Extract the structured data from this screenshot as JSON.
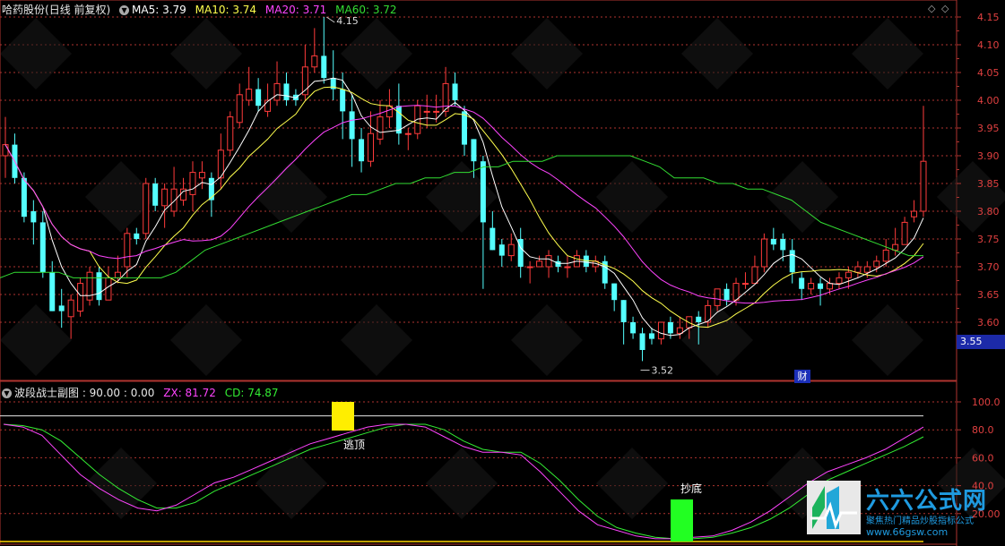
{
  "main_panel": {
    "stock_name": "哈药股份",
    "period": "(日线 前复权)",
    "ma5": "MA5: 3.79",
    "ma10": "MA10: 3.74",
    "ma20": "MA20: 3.71",
    "ma60": "MA60: 3.72",
    "high_mark": "4.15",
    "low_mark": "3.52",
    "price_tag": "3.55",
    "fin_badge": "财"
  },
  "sub_panel": {
    "title": "波段战士副图 : 90.00 : 0.00",
    "zx": "ZX: 81.72",
    "cd": "CD: 74.87",
    "escape_label": "逃顶",
    "bottom_label": "抄底"
  },
  "watermark": {
    "logo_text": "六六公式网",
    "tagline": "聚焦热门精品炒股指标公式",
    "url": "www.66gsw.com"
  },
  "colors": {
    "up": "#ff3b3b",
    "down": "#54ffff",
    "ma5": "#ffffff",
    "ma10": "#ffff4d",
    "ma20": "#ff44ff",
    "ma60": "#33dd33",
    "axis": "#b0342f",
    "zx": "#ff44ff",
    "cd": "#33ee33"
  },
  "chart_data": [
    {
      "type": "candlestick",
      "y_ticks": [
        4.15,
        4.1,
        4.05,
        4.0,
        3.95,
        3.9,
        3.85,
        3.8,
        3.75,
        3.7,
        3.65,
        3.6
      ],
      "ylim": [
        3.52,
        4.16
      ],
      "candles": [
        [
          3.9,
          3.92,
          3.86,
          3.97
        ],
        [
          3.92,
          3.86,
          3.85,
          3.94
        ],
        [
          3.86,
          3.79,
          3.78,
          3.87
        ],
        [
          3.8,
          3.78,
          3.74,
          3.82
        ],
        [
          3.78,
          3.69,
          3.68,
          3.8
        ],
        [
          3.69,
          3.62,
          3.62,
          3.71
        ],
        [
          3.63,
          3.62,
          3.59,
          3.66
        ],
        [
          3.61,
          3.64,
          3.57,
          3.65
        ],
        [
          3.62,
          3.67,
          3.61,
          3.68
        ],
        [
          3.64,
          3.69,
          3.63,
          3.7
        ],
        [
          3.69,
          3.64,
          3.63,
          3.7
        ],
        [
          3.64,
          3.68,
          3.64,
          3.7
        ],
        [
          3.68,
          3.69,
          3.67,
          3.72
        ],
        [
          3.7,
          3.76,
          3.68,
          3.77
        ],
        [
          3.76,
          3.75,
          3.74,
          3.77
        ],
        [
          3.76,
          3.85,
          3.75,
          3.86
        ],
        [
          3.85,
          3.81,
          3.8,
          3.86
        ],
        [
          3.81,
          3.84,
          3.77,
          3.85
        ],
        [
          3.8,
          3.84,
          3.79,
          3.88
        ],
        [
          3.82,
          3.84,
          3.81,
          3.86
        ],
        [
          3.83,
          3.87,
          3.8,
          3.89
        ],
        [
          3.86,
          3.87,
          3.84,
          3.89
        ],
        [
          3.86,
          3.82,
          3.79,
          3.87
        ],
        [
          3.86,
          3.91,
          3.84,
          3.94
        ],
        [
          3.91,
          3.97,
          3.9,
          3.98
        ],
        [
          3.96,
          4.01,
          3.95,
          4.03
        ],
        [
          4.0,
          4.02,
          3.99,
          4.06
        ],
        [
          4.02,
          3.99,
          3.98,
          4.04
        ],
        [
          3.98,
          4.0,
          3.97,
          4.03
        ],
        [
          4.0,
          4.03,
          3.99,
          4.07
        ],
        [
          4.03,
          4.0,
          3.99,
          4.05
        ],
        [
          4.01,
          4.0,
          3.99,
          4.02
        ],
        [
          4.01,
          4.06,
          4.0,
          4.1
        ],
        [
          4.06,
          4.08,
          4.05,
          4.13
        ],
        [
          4.08,
          4.04,
          4.03,
          4.15
        ],
        [
          4.04,
          4.02,
          4.0,
          4.09
        ],
        [
          4.02,
          3.98,
          3.93,
          4.05
        ],
        [
          3.98,
          3.93,
          3.88,
          4.01
        ],
        [
          3.93,
          3.89,
          3.87,
          3.95
        ],
        [
          3.89,
          3.94,
          3.88,
          3.98
        ],
        [
          3.93,
          3.97,
          3.92,
          4.0
        ],
        [
          3.97,
          3.99,
          3.95,
          4.02
        ],
        [
          3.99,
          3.94,
          3.92,
          4.03
        ],
        [
          3.94,
          3.94,
          3.91,
          3.95
        ],
        [
          3.94,
          3.99,
          3.93,
          4.0
        ],
        [
          3.98,
          3.98,
          3.95,
          4.01
        ],
        [
          3.98,
          3.98,
          3.96,
          4.01
        ],
        [
          3.98,
          4.03,
          3.97,
          4.06
        ],
        [
          4.03,
          4.0,
          3.99,
          4.05
        ],
        [
          3.98,
          3.92,
          3.9,
          3.99
        ],
        [
          3.93,
          3.89,
          3.86,
          3.93
        ],
        [
          3.89,
          3.78,
          3.66,
          3.9
        ],
        [
          3.77,
          3.73,
          3.73,
          3.8
        ],
        [
          3.74,
          3.72,
          3.7,
          3.75
        ],
        [
          3.72,
          3.74,
          3.71,
          3.76
        ],
        [
          3.75,
          3.7,
          3.68,
          3.77
        ],
        [
          3.7,
          3.7,
          3.67,
          3.71
        ],
        [
          3.7,
          3.71,
          3.7,
          3.72
        ],
        [
          3.7,
          3.72,
          3.68,
          3.73
        ],
        [
          3.71,
          3.7,
          3.69,
          3.72
        ],
        [
          3.7,
          3.7,
          3.68,
          3.72
        ],
        [
          3.7,
          3.72,
          3.7,
          3.73
        ],
        [
          3.72,
          3.7,
          3.69,
          3.73
        ],
        [
          3.7,
          3.71,
          3.69,
          3.72
        ],
        [
          3.71,
          3.67,
          3.66,
          3.72
        ],
        [
          3.67,
          3.64,
          3.62,
          3.67
        ],
        [
          3.64,
          3.6,
          3.56,
          3.64
        ],
        [
          3.6,
          3.58,
          3.57,
          3.61
        ],
        [
          3.58,
          3.55,
          3.53,
          3.59
        ],
        [
          3.58,
          3.57,
          3.56,
          3.59
        ],
        [
          3.57,
          3.6,
          3.56,
          3.6
        ],
        [
          3.6,
          3.58,
          3.57,
          3.61
        ],
        [
          3.58,
          3.59,
          3.57,
          3.61
        ],
        [
          3.59,
          3.61,
          3.57,
          3.61
        ],
        [
          3.61,
          3.6,
          3.56,
          3.62
        ],
        [
          3.6,
          3.63,
          3.59,
          3.64
        ],
        [
          3.63,
          3.66,
          3.62,
          3.66
        ],
        [
          3.66,
          3.64,
          3.63,
          3.67
        ],
        [
          3.64,
          3.67,
          3.63,
          3.68
        ],
        [
          3.67,
          3.67,
          3.66,
          3.69
        ],
        [
          3.67,
          3.7,
          3.67,
          3.72
        ],
        [
          3.7,
          3.75,
          3.69,
          3.76
        ],
        [
          3.75,
          3.74,
          3.73,
          3.77
        ],
        [
          3.75,
          3.73,
          3.71,
          3.76
        ],
        [
          3.73,
          3.69,
          3.67,
          3.75
        ],
        [
          3.68,
          3.66,
          3.64,
          3.69
        ],
        [
          3.66,
          3.67,
          3.65,
          3.68
        ],
        [
          3.67,
          3.66,
          3.63,
          3.68
        ],
        [
          3.66,
          3.67,
          3.65,
          3.68
        ],
        [
          3.67,
          3.68,
          3.66,
          3.69
        ],
        [
          3.68,
          3.69,
          3.66,
          3.7
        ],
        [
          3.69,
          3.7,
          3.68,
          3.71
        ],
        [
          3.69,
          3.7,
          3.68,
          3.71
        ],
        [
          3.7,
          3.71,
          3.69,
          3.72
        ],
        [
          3.71,
          3.73,
          3.7,
          3.75
        ],
        [
          3.73,
          3.74,
          3.72,
          3.77
        ],
        [
          3.74,
          3.78,
          3.74,
          3.79
        ],
        [
          3.79,
          3.8,
          3.78,
          3.82
        ],
        [
          3.8,
          3.89,
          3.79,
          3.99
        ]
      ],
      "ma60": [
        3.68,
        3.69,
        3.69,
        3.69,
        3.69,
        3.68,
        3.68,
        3.68,
        3.68,
        3.68,
        3.68,
        3.68,
        3.69,
        3.71,
        3.73,
        3.74,
        3.75,
        3.76,
        3.77,
        3.78,
        3.79,
        3.8,
        3.81,
        3.82,
        3.83,
        3.83,
        3.84,
        3.85,
        3.85,
        3.86,
        3.86,
        3.87,
        3.87,
        3.88,
        3.88,
        3.89,
        3.89,
        3.89,
        3.9,
        3.9,
        3.9,
        3.9,
        3.9,
        3.9,
        3.89,
        3.88,
        3.86,
        3.86,
        3.86,
        3.85,
        3.85,
        3.84,
        3.84,
        3.83,
        3.82,
        3.8,
        3.78,
        3.77,
        3.76,
        3.75,
        3.74,
        3.73,
        3.72,
        3.72
      ]
    },
    {
      "type": "line",
      "title": "波段战士副图",
      "y_ticks": [
        100.0,
        80.0,
        60.0,
        40.0,
        20.0
      ],
      "ylim": [
        0,
        110
      ],
      "series": [
        {
          "name": "ZX",
          "values": [
            84,
            82,
            76,
            62,
            48,
            38,
            30,
            24,
            22,
            26,
            34,
            42,
            46,
            52,
            58,
            64,
            70,
            74,
            78,
            82,
            84,
            84,
            82,
            75,
            68,
            64,
            64,
            62,
            50,
            36,
            22,
            12,
            8,
            4,
            2,
            2,
            3,
            4,
            8,
            14,
            22,
            32,
            42,
            50,
            55,
            60,
            66,
            74,
            82
          ]
        },
        {
          "name": "CD",
          "values": [
            84,
            83,
            80,
            72,
            60,
            48,
            38,
            30,
            24,
            24,
            28,
            36,
            42,
            48,
            54,
            60,
            66,
            70,
            74,
            78,
            82,
            84,
            84,
            80,
            72,
            66,
            64,
            64,
            56,
            44,
            30,
            18,
            10,
            6,
            3,
            2,
            2,
            3,
            6,
            10,
            16,
            24,
            34,
            44,
            50,
            56,
            62,
            68,
            75
          ]
        }
      ]
    }
  ]
}
